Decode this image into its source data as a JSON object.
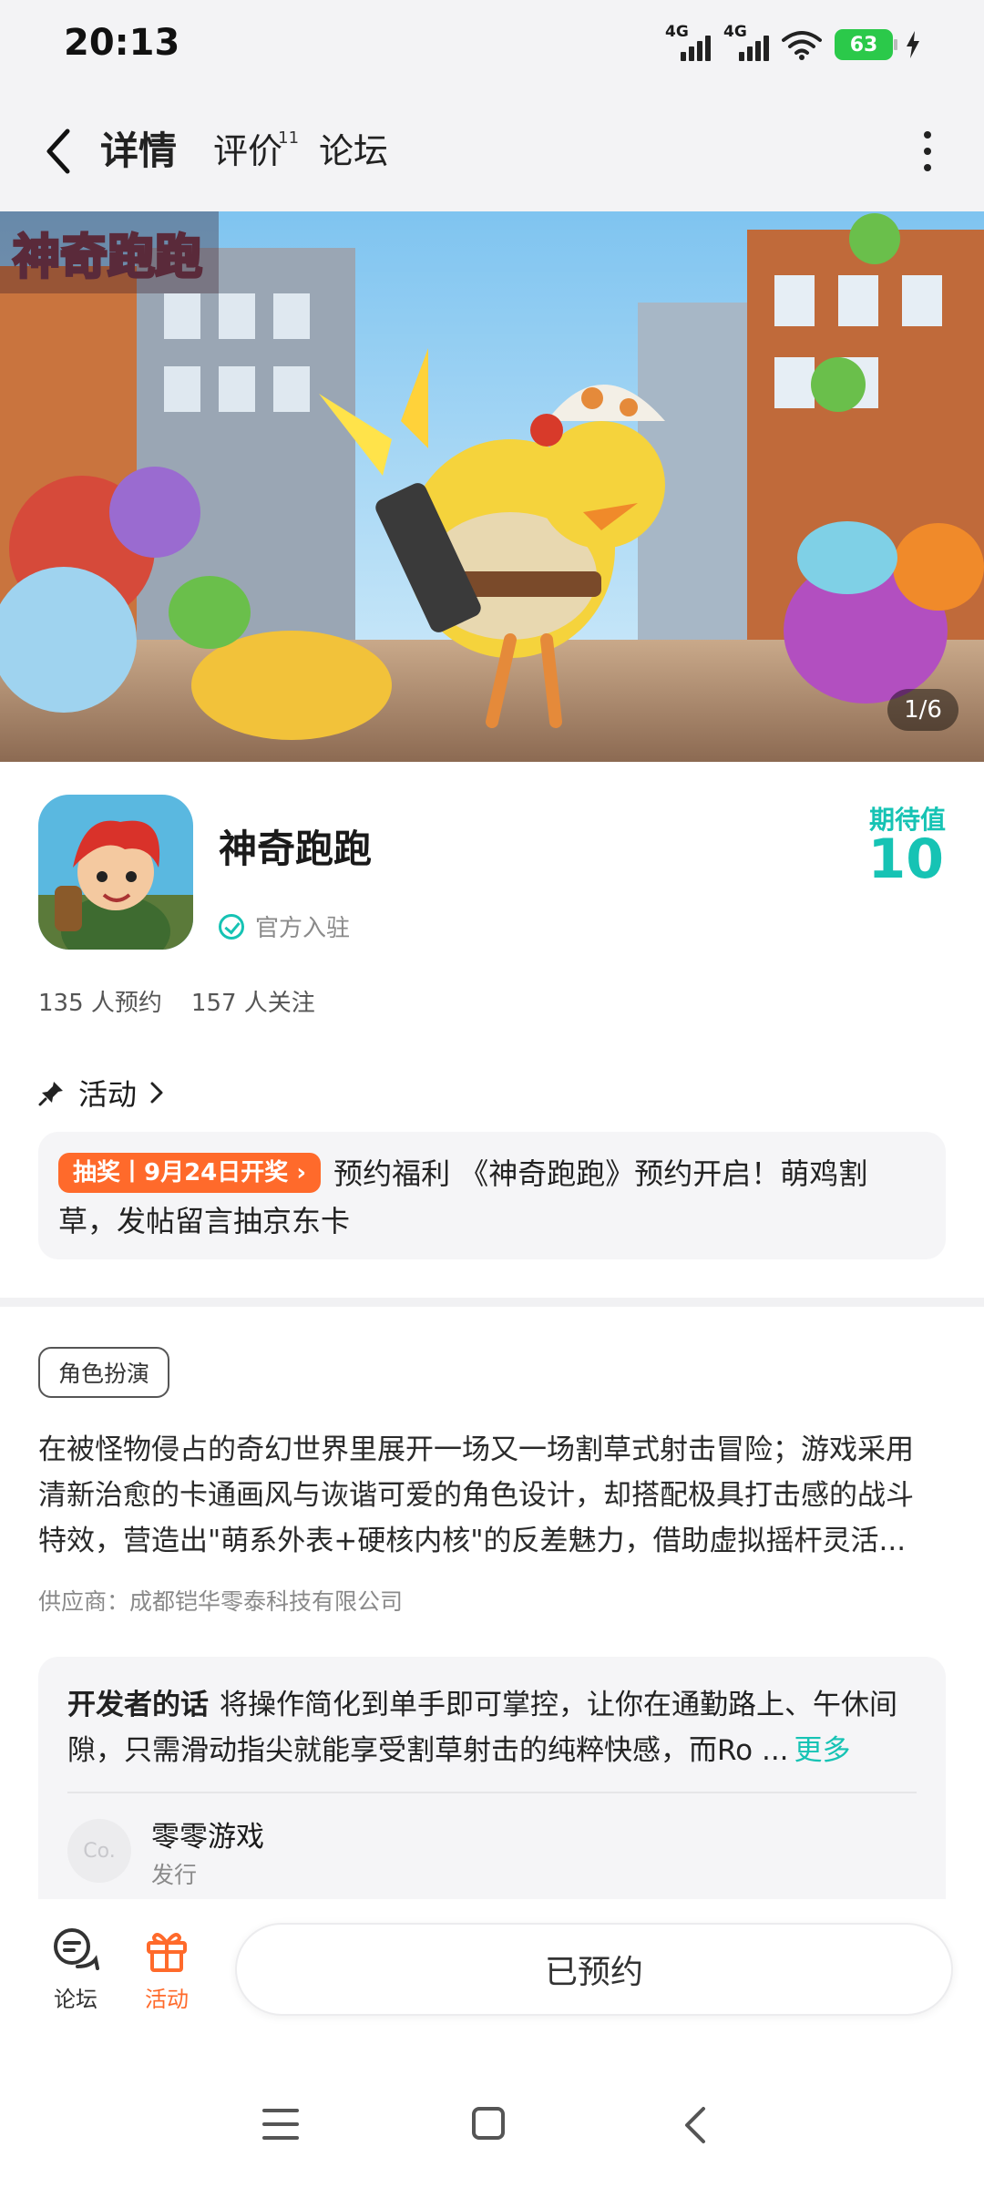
{
  "status_bar": {
    "time": "20:13",
    "signal1_label": "4G",
    "signal2_label": "4G",
    "battery": "63"
  },
  "nav": {
    "tabs": [
      {
        "label": "详情",
        "active": true
      },
      {
        "label": "评价",
        "badge": "11"
      },
      {
        "label": "论坛"
      }
    ]
  },
  "banner": {
    "title_art": "神奇跑跑",
    "counter": "1/6"
  },
  "app": {
    "name": "神奇跑跑",
    "official_label": "官方入驻",
    "expect_label": "期待值",
    "expect_value": "10",
    "reservations": "135 人预约",
    "followers": "157 人关注"
  },
  "activity": {
    "heading": "活动",
    "tag": "抽奖丨9月24日开奖",
    "text": "预约福利 《神奇跑跑》预约开启！萌鸡割草，发帖留言抽京东卡"
  },
  "details": {
    "genre_tag": "角色扮演",
    "description_lines": [
      "在被怪物侵占的奇幻世界里展开一场又一场割草式射击冒险；游戏采用",
      "清新治愈的卡通画风与诙谐可爱的角色设计，却搭配极具打击感的战斗",
      "特效，营造出\"萌系外表+硬核内核\"的反差魅力，借助虚拟摇杆灵活..."
    ],
    "supplier": "供应商：成都铠华零泰科技有限公司"
  },
  "developer": {
    "title": "开发者的话",
    "text": "将操作简化到单手即可掌控，让你在通勤路上、午休间隙，只需滑动指尖就能享受割草射击的纯粹快感，而Ro ...",
    "more": "更多",
    "publisher_avatar": "Co.",
    "publisher_name": "零零游戏",
    "publisher_role": "发行"
  },
  "bottom_bar": {
    "forum_label": "论坛",
    "activity_label": "活动",
    "action_label": "已预约"
  },
  "colors": {
    "accent": "#16c3b4",
    "activity_orange": "#ff6a2b",
    "battery_green": "#2bc94a"
  }
}
